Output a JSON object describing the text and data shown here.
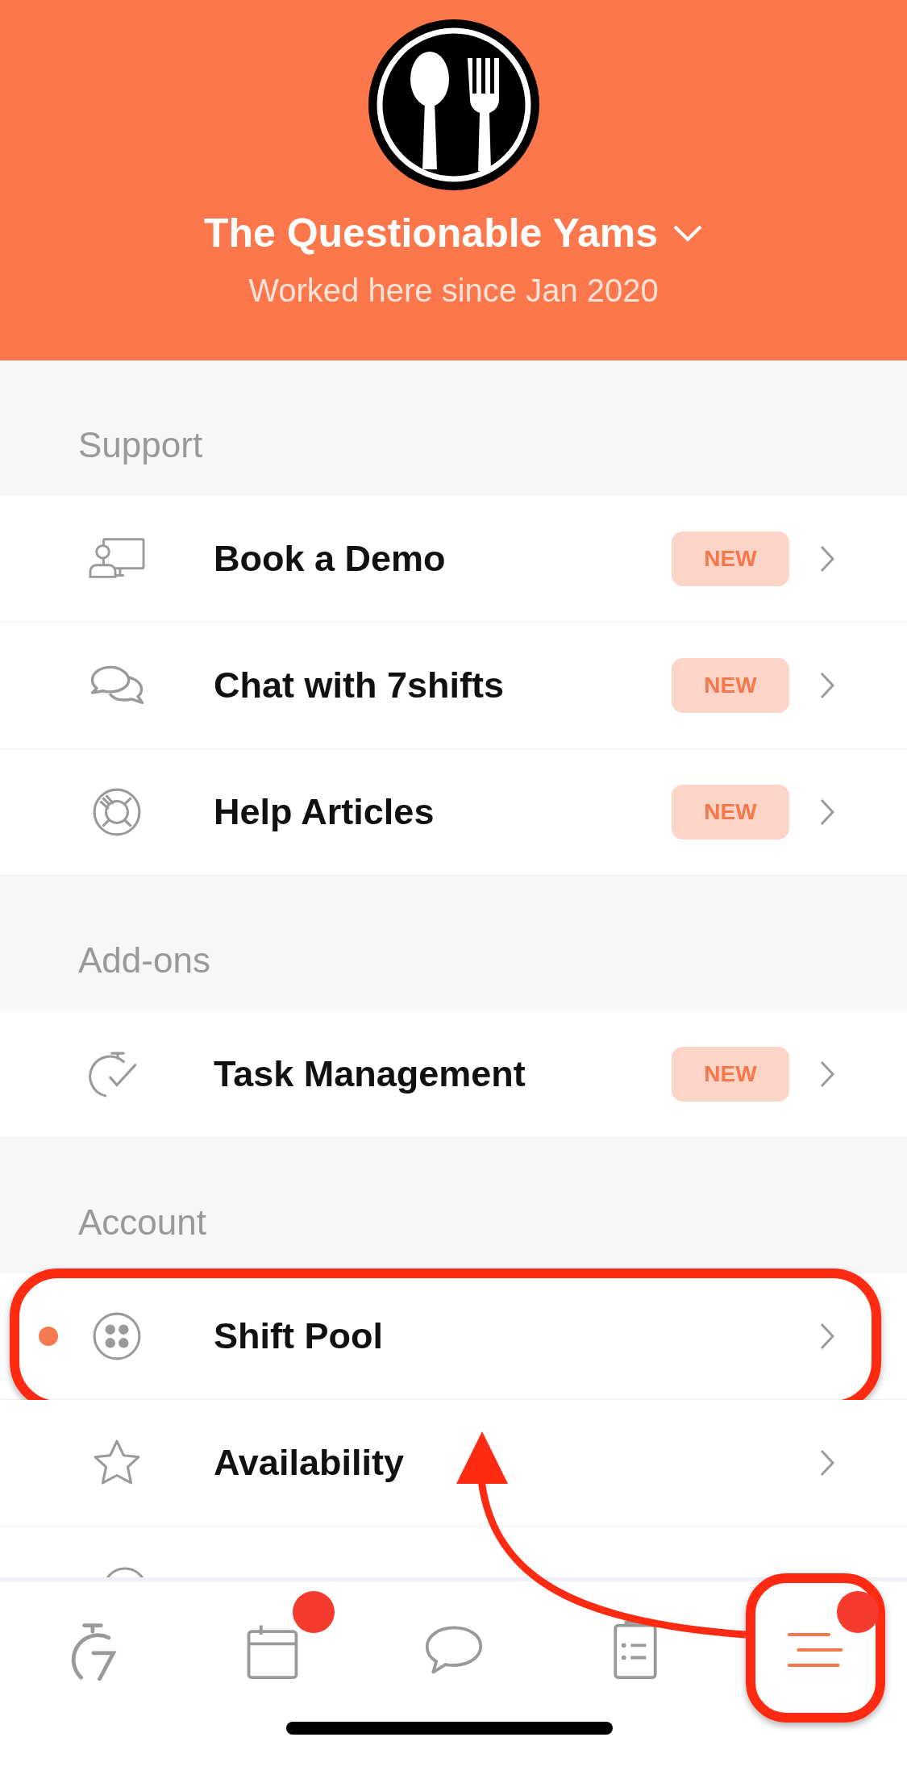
{
  "header": {
    "title": "The Questionable Yams",
    "subtitle": "Worked here since Jan 2020"
  },
  "sections": [
    {
      "title": "Support",
      "items": [
        {
          "kind": "demo",
          "label": "Book a Demo",
          "badge": "NEW",
          "unread": false,
          "highlighted": false
        },
        {
          "kind": "chat",
          "label": "Chat with 7shifts",
          "badge": "NEW",
          "unread": false,
          "highlighted": false
        },
        {
          "kind": "help",
          "label": "Help Articles",
          "badge": "NEW",
          "unread": false,
          "highlighted": false
        }
      ]
    },
    {
      "title": "Add-ons",
      "items": [
        {
          "kind": "task",
          "label": "Task Management",
          "badge": "NEW",
          "unread": false,
          "highlighted": false
        }
      ]
    },
    {
      "title": "Account",
      "items": [
        {
          "kind": "pool",
          "label": "Shift Pool",
          "unread": true,
          "highlighted": true
        },
        {
          "kind": "star",
          "label": "Availability",
          "unread": false,
          "highlighted": false
        }
      ]
    }
  ],
  "tabs": [
    {
      "kind": "timer",
      "selected": false,
      "notification": false,
      "highlighted": false
    },
    {
      "kind": "calendar",
      "selected": false,
      "notification": true,
      "highlighted": false
    },
    {
      "kind": "chat",
      "selected": false,
      "notification": false,
      "highlighted": false
    },
    {
      "kind": "tasks",
      "selected": false,
      "notification": false,
      "highlighted": false
    },
    {
      "kind": "menu",
      "selected": true,
      "notification": true,
      "highlighted": true
    }
  ]
}
